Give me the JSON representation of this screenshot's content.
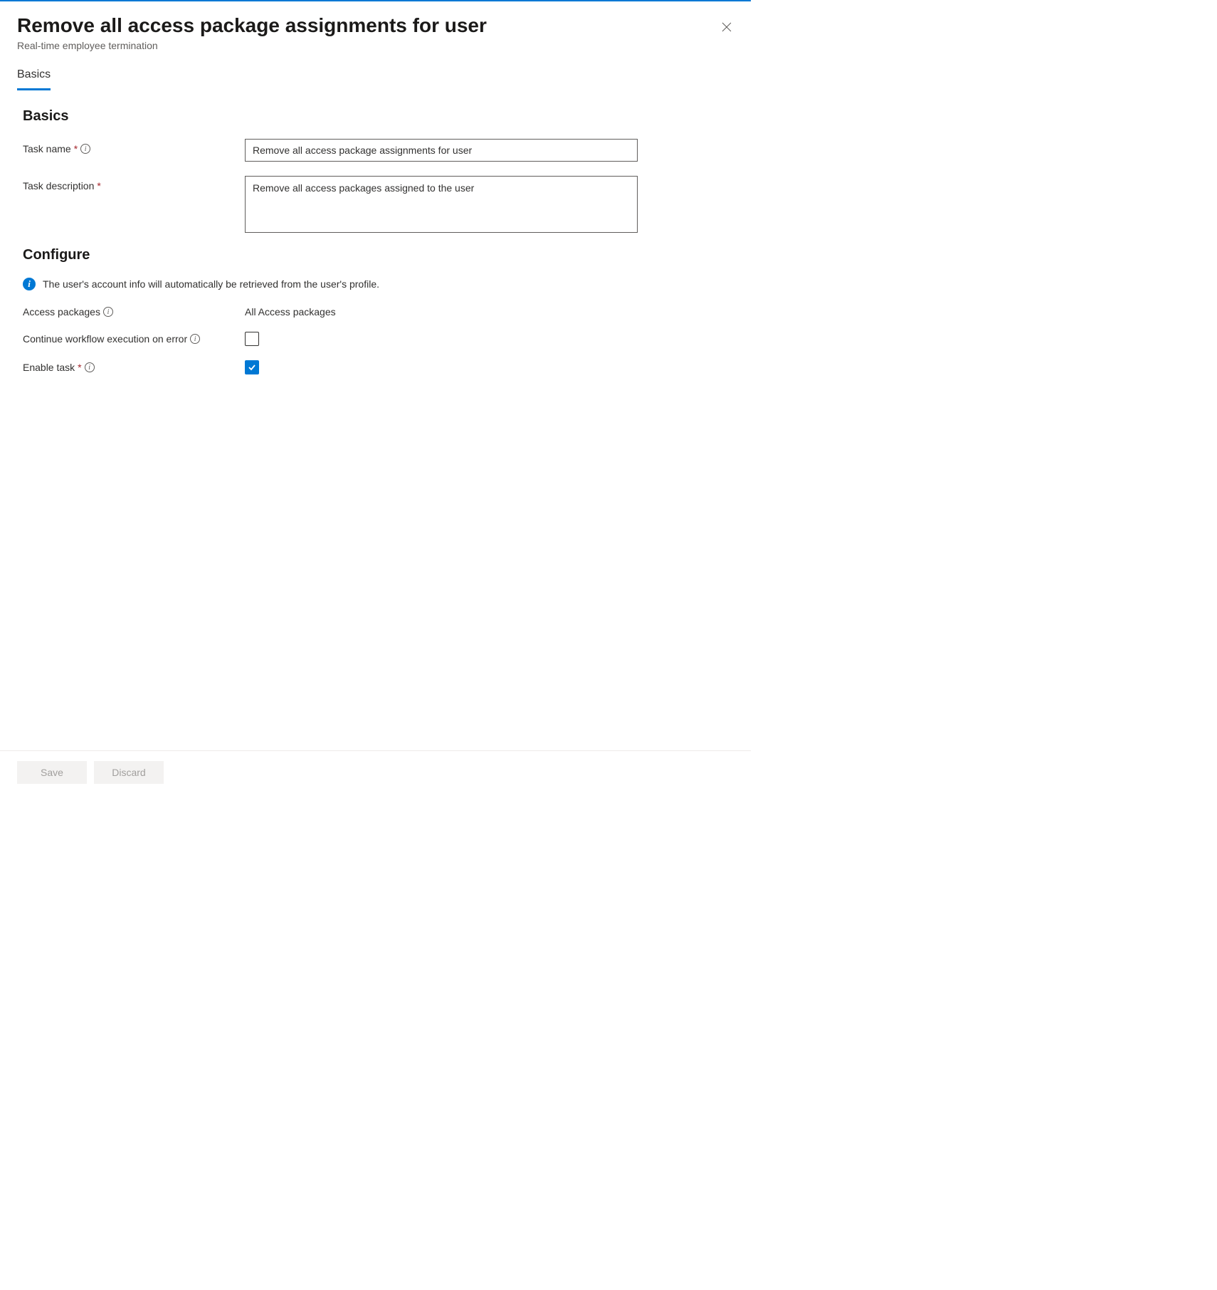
{
  "header": {
    "title": "Remove all access package assignments for user",
    "subtitle": "Real-time employee termination"
  },
  "tabs": {
    "basics": "Basics"
  },
  "sections": {
    "basics_heading": "Basics",
    "configure_heading": "Configure"
  },
  "fields": {
    "task_name_label": "Task name",
    "task_name_value": "Remove all access package assignments for user",
    "task_description_label": "Task description",
    "task_description_value": "Remove all access packages assigned to the user",
    "access_packages_label": "Access packages",
    "access_packages_value": "All Access packages",
    "continue_on_error_label": "Continue workflow execution on error",
    "enable_task_label": "Enable task"
  },
  "info_banner": "The user's account info will automatically be retrieved from the user's profile.",
  "footer": {
    "save": "Save",
    "discard": "Discard"
  }
}
